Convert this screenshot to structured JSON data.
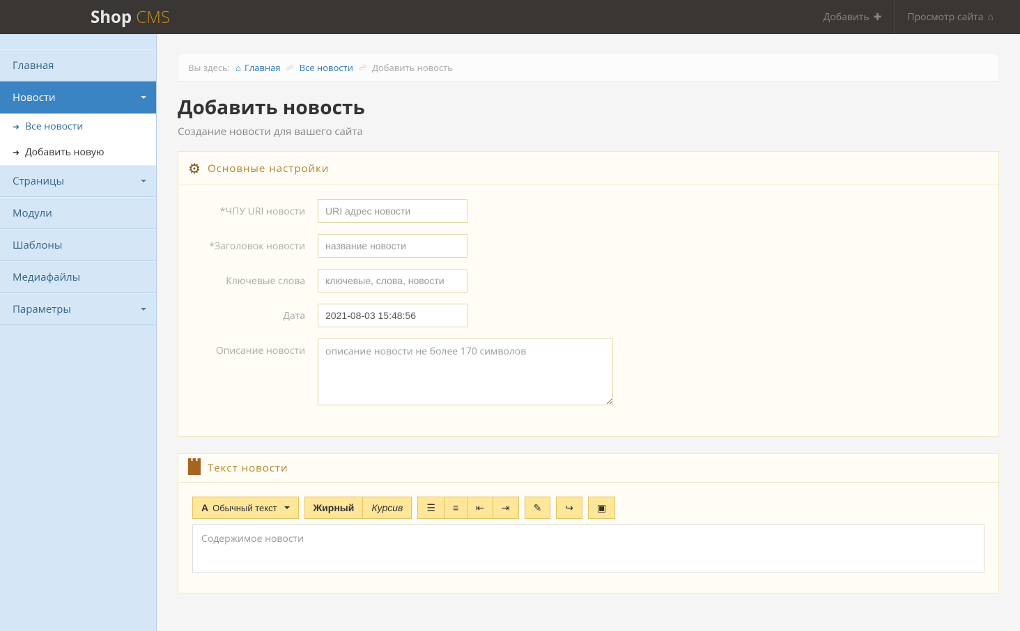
{
  "brand": {
    "shop": "Shop",
    "cms": " CMS"
  },
  "topnav": {
    "add": "Добавить",
    "view_site": "Просмотр сайта"
  },
  "sidebar": {
    "home": "Главная",
    "news": "Новости",
    "all_news": "Все новости",
    "add_new": "Добавить новую",
    "pages": "Страницы",
    "modules": "Модули",
    "templates": "Шаблоны",
    "media": "Медиафайлы",
    "params": "Параметры"
  },
  "breadcrumb": {
    "here": "Вы здесь:",
    "home": "Главная",
    "all_news": "Все новости",
    "current": "Добавить новость"
  },
  "page": {
    "title": "Добавить новость",
    "subtitle": "Создание новости для вашего сайта"
  },
  "panel1": {
    "title": "Основные настройки",
    "fields": {
      "uri_label": "*ЧПУ URI новости",
      "uri_placeholder": "URI адрес новости",
      "title_label": "*Заголовок новости",
      "title_placeholder": "название новости",
      "keywords_label": "Ключевые слова",
      "keywords_placeholder": "ключевые, слова, новости",
      "date_label": "Дата",
      "date_value": "2021-08-03 15:48:56",
      "desc_label": "Описание новости",
      "desc_placeholder": "описание новости не более 170 символов"
    }
  },
  "panel2": {
    "title": "Текст новости",
    "toolbar": {
      "style_prefix": "Обычный текст",
      "bold": "Жирный",
      "italic": "Курсив"
    },
    "editor_placeholder": "Содержимое новости"
  }
}
